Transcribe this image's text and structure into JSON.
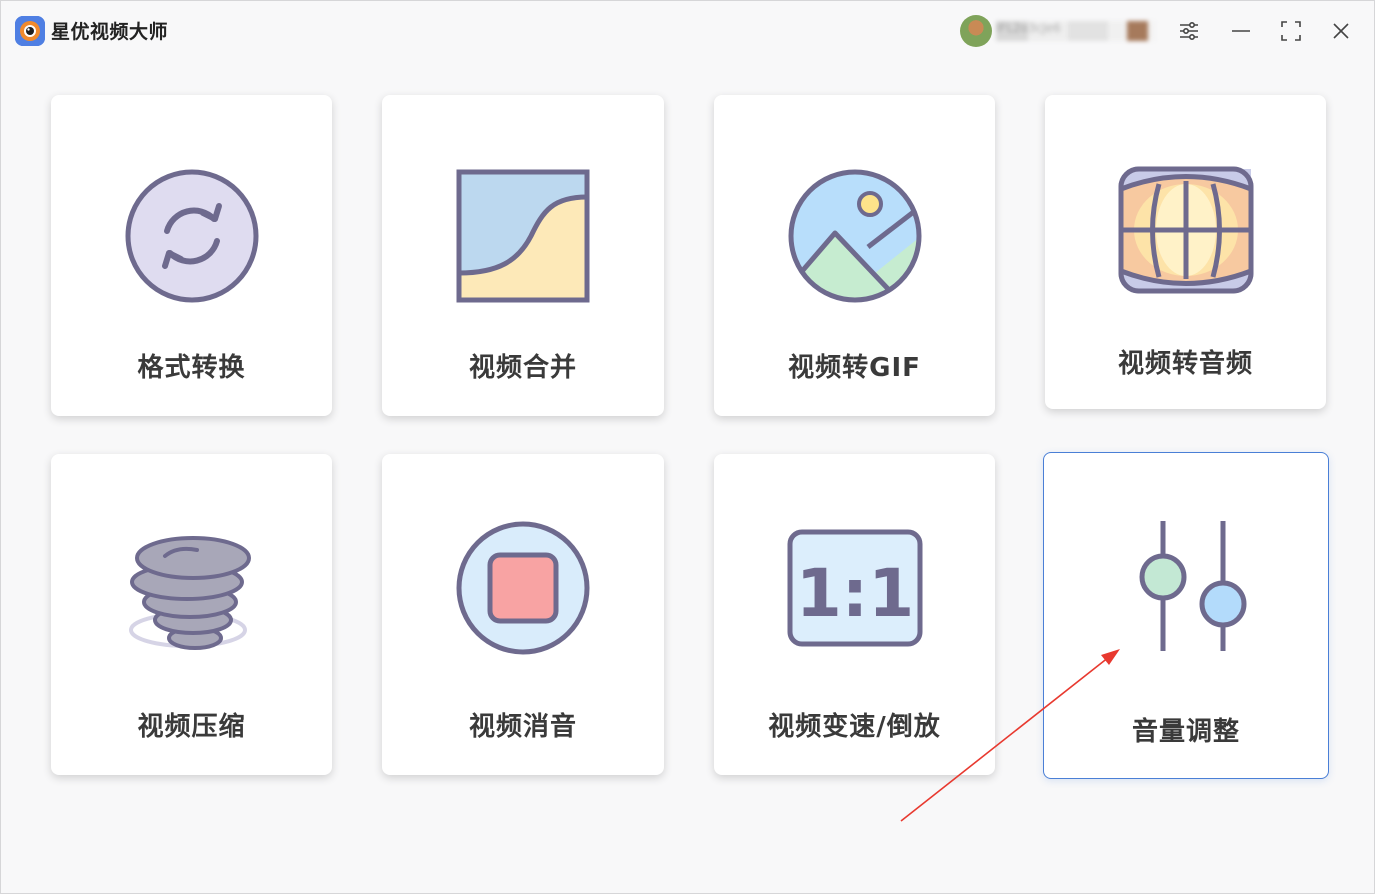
{
  "app": {
    "title": "星优视频大师",
    "username": "IFL2o3cJe6"
  },
  "tools": [
    {
      "label": "格式转换",
      "icon": "refresh-arrows-icon"
    },
    {
      "label": "视频合并",
      "icon": "merge-curve-icon"
    },
    {
      "label": "视频转GIF",
      "icon": "landscape-image-icon"
    },
    {
      "label": "视频转音频",
      "icon": "audio-globe-icon"
    },
    {
      "label": "视频压缩",
      "icon": "tornado-icon"
    },
    {
      "label": "视频消音",
      "icon": "stop-square-icon"
    },
    {
      "label": "视频变速/倒放",
      "icon": "ratio-1-1-icon"
    },
    {
      "label": "音量调整",
      "icon": "volume-sliders-icon"
    }
  ],
  "numbers": {
    "ratio_icon_text": "1:1"
  },
  "colors": {
    "accent_border": "#4a7fd6",
    "icon_stroke": "#6e6a8e",
    "annotation_arrow": "#e8392f"
  }
}
